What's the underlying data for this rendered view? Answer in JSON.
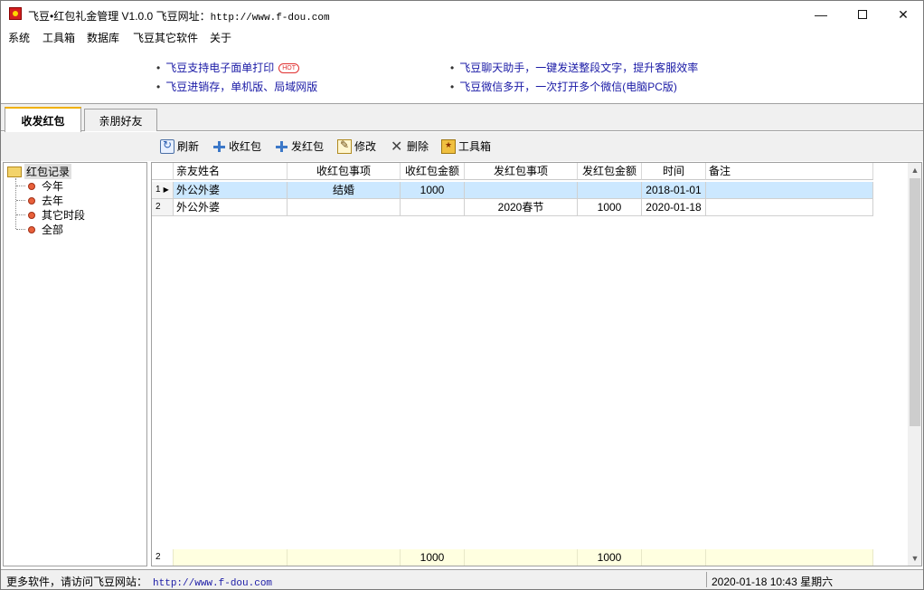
{
  "window": {
    "title": "飞豆•红包礼金管理 V1.0.0  飞豆网址：",
    "title_url": "http://www.f-dou.com",
    "min_icon": "minimize-icon",
    "max_icon": "maximize-icon",
    "close_icon": "close-icon"
  },
  "menu": [
    "系统",
    "工具箱",
    "数据库",
    "飞豆其它软件",
    "关于"
  ],
  "ads": [
    {
      "text": "飞豆支持电子面单打印",
      "hot": "HOT"
    },
    {
      "text": "飞豆进销存，单机版、局域网版"
    },
    {
      "text": "飞豆聊天助手，一键发送整段文字，提升客服效率"
    },
    {
      "text": "飞豆微信多开，一次打开多个微信(电脑PC版)"
    }
  ],
  "tabs": [
    {
      "label": "收发红包",
      "active": true
    },
    {
      "label": "亲朋好友",
      "active": false
    }
  ],
  "toolbar": {
    "refresh": "刷新",
    "receive": "收红包",
    "send": "发红包",
    "edit": "修改",
    "delete": "删除",
    "tools": "工具箱"
  },
  "tree": {
    "root": "红包记录",
    "items": [
      "今年",
      "去年",
      "其它时段",
      "全部"
    ]
  },
  "grid": {
    "columns": [
      "亲友姓名",
      "收红包事项",
      "收红包金额",
      "发红包事项",
      "发红包金额",
      "时间",
      "备注"
    ],
    "rows": [
      {
        "no": "1",
        "name": "外公外婆",
        "recv_item": "结婚",
        "recv_amount": "1000",
        "send_item": "",
        "send_amount": "",
        "date": "2018-01-01",
        "note": ""
      },
      {
        "no": "2",
        "name": "外公外婆",
        "recv_item": "",
        "recv_amount": "",
        "send_item": "2020春节",
        "send_amount": "1000",
        "date": "2020-01-18",
        "note": ""
      }
    ],
    "footer": {
      "count": "2",
      "recv_total": "1000",
      "send_total": "1000"
    }
  },
  "status": {
    "left_text": "更多软件，请访问飞豆网站：",
    "left_url": "http://www.f-dou.com",
    "right_text": "2020-01-18 10:43 星期六"
  }
}
